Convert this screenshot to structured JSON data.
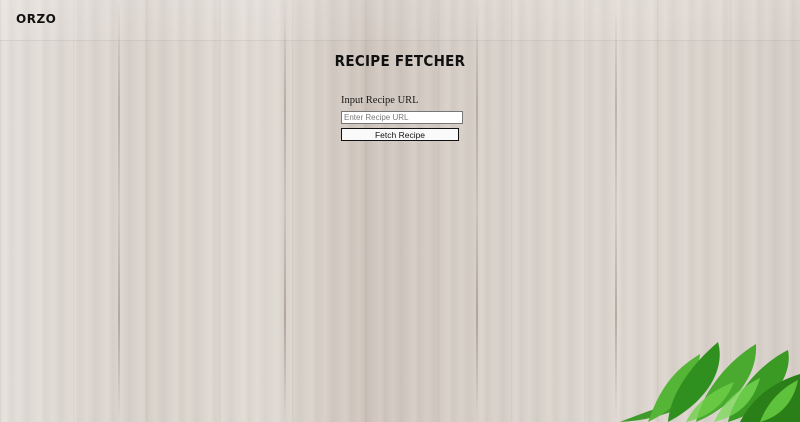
{
  "header": {
    "logo": "ORZO"
  },
  "main": {
    "title": "RECIPE FETCHER",
    "input_label": "Input Recipe URL",
    "input_placeholder": "Enter Recipe URL",
    "input_value": "",
    "button_label": "Fetch Recipe"
  },
  "decor": {
    "plant_icon": "leaves-icon",
    "background": "wood-texture"
  },
  "colors": {
    "text": "#111111",
    "leaf_dark": "#2f8f1f",
    "leaf_light": "#58c23a"
  }
}
